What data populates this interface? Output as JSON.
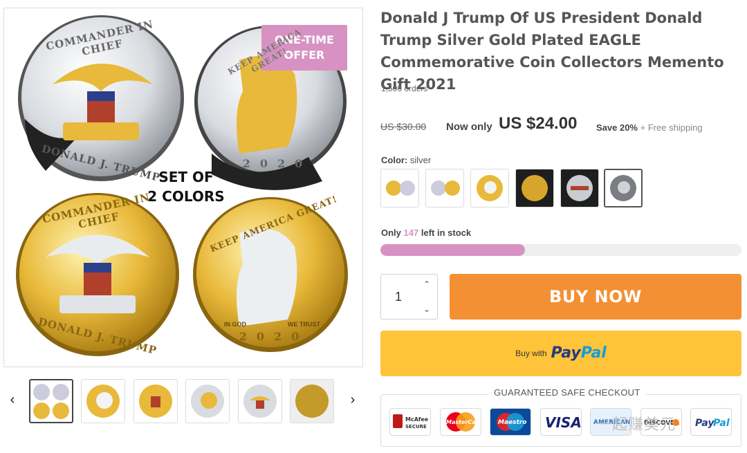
{
  "gallery": {
    "offer_badge": "ONE-TIME OFFER",
    "set_line1": "SET OF",
    "set_line2": "2 COLORS",
    "coin_text_commander": "COMMANDER IN CHIEF",
    "coin_text_donald": "DONALD J. TRUMP",
    "coin_text_keep": "KEEP AMERICA GREAT!",
    "coin_year": "2020",
    "coin_in_god": "IN GOD",
    "coin_we_trust": "WE TRUST",
    "prev_icon": "chevron-left-icon",
    "next_icon": "chevron-right-icon",
    "thumbnail_count": 6,
    "active_thumbnail": 1
  },
  "product": {
    "title": "Donald J Trump Of US President Donald Trump Silver Gold Plated EAGLE Commemorative Coin Collectors Memento Gift 2021",
    "orders": "1,506 orders",
    "old_price": "US $30.00",
    "now_label": "Now only",
    "now_price": "US $24.00",
    "save": "Save 20%",
    "free_shipping": "+ Free shipping",
    "color_label": "Color:",
    "color_value": "silver",
    "swatch_count": 6,
    "active_swatch": 6,
    "stock_prefix": "Only",
    "stock_count": "147",
    "stock_suffix": "left in stock",
    "stock_fraction": 0.4,
    "quantity": "1",
    "buy_now": "BUY NOW",
    "paypal_prefix": "Buy with",
    "paypal_logo_a": "Pay",
    "paypal_logo_b": "Pal"
  },
  "checkout": {
    "title": "GUARANTEED SAFE CHECKOUT",
    "logos": [
      "McAfee SECURE",
      "MasterCard",
      "Maestro",
      "VISA",
      "American Express",
      "Discover",
      "PayPal"
    ]
  },
  "watermark": "一起赚美元",
  "colors": {
    "accent_pink": "#d792c3",
    "buy_orange": "#f39034",
    "paypal_yellow": "#ffc43a",
    "gold": "#e8b93a",
    "silver": "#c9ccd1"
  }
}
